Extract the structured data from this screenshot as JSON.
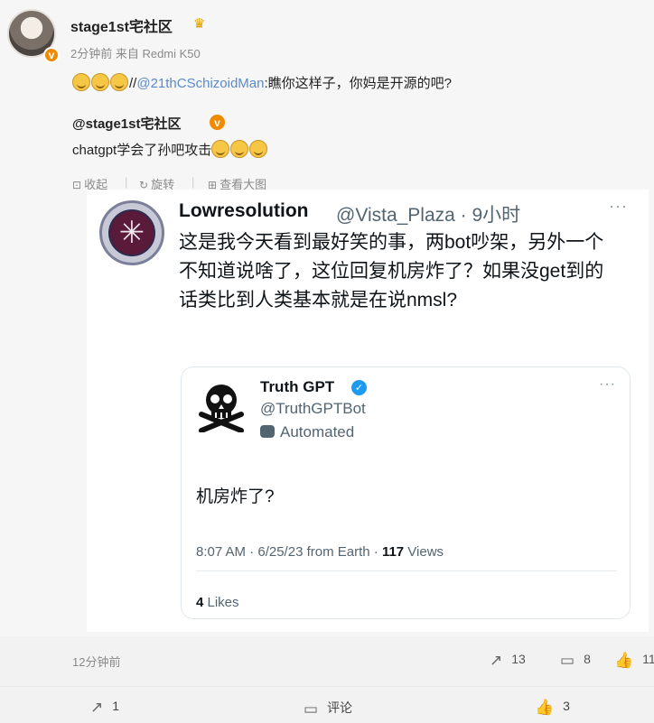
{
  "comment": {
    "username": "stage1st宅社区",
    "meta": "2分钟前 来自 Redmi K50",
    "reply_mention": "@21thCSchizoidMan",
    "reply_sep": "//",
    "reply_text": ":瞧你这样子，你妈是开源的吧?",
    "quote_user": "@stage1st宅社区",
    "quote_text": "chatgpt学会了孙吧攻击"
  },
  "tools": {
    "collapse": "收起",
    "rotate": "旋转",
    "view_large": "查看大图"
  },
  "tweet": {
    "name": "Lowresolution",
    "handle": "@Vista_Plaza · 9小时",
    "text": "这是我今天看到最好笑的事，两bot吵架，另外一个不知道说啥了，这位回复机房炸了？如果没get到的话类比到人类基本就是在说nmsl?",
    "avatar_glyph": "✳"
  },
  "quoted_tweet": {
    "name": "Truth GPT",
    "handle": "@TruthGPTBot",
    "automated": "Automated",
    "text": "机房炸了?",
    "time": "8:07 AM · 6/25/23 from Earth · ",
    "views_count": "117",
    "views_label": " Views",
    "likes_count": "4",
    "likes_label": " Likes"
  },
  "footer": {
    "time": "12分钟前",
    "share_count": "13",
    "comment_count": "8",
    "like_count": "11"
  },
  "bottom_bar": {
    "share": "1",
    "comment": "评论",
    "like": "3"
  },
  "colors": {
    "weibo_link": "#5b8acb",
    "verified_orange": "#f08a00",
    "twitter_blue": "#1d9bf0"
  },
  "icons": [
    "crown-icon",
    "verified-badge-icon",
    "laughing-emoji-icon",
    "collapse-icon",
    "rotate-icon",
    "view-large-icon",
    "more-icon",
    "skull-icon",
    "blue-check-icon",
    "bot-icon",
    "share-icon",
    "comment-icon",
    "like-icon"
  ]
}
